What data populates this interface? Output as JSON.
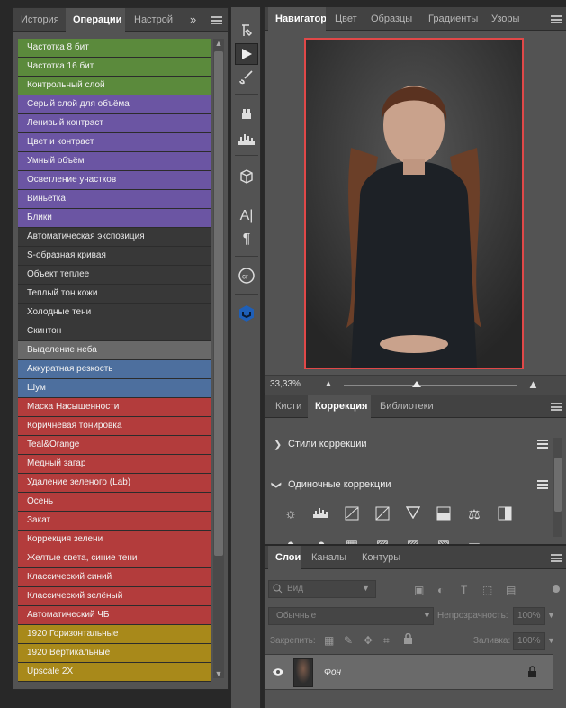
{
  "panel_left": {
    "tabs": [
      "История",
      "Операции",
      "Настрой"
    ],
    "active_tab": "Операции",
    "actions": [
      {
        "label": "Частотка 8 бит",
        "color": "green"
      },
      {
        "label": "Частотка 16 бит",
        "color": "green"
      },
      {
        "label": "Контрольный слой",
        "color": "green"
      },
      {
        "label": "Серый слой для объёма",
        "color": "purple"
      },
      {
        "label": "Ленивый контраст",
        "color": "purple"
      },
      {
        "label": "Цвет и контраст",
        "color": "purple"
      },
      {
        "label": "Умный объём",
        "color": "purple"
      },
      {
        "label": "Осветление участков",
        "color": "purple"
      },
      {
        "label": "Виньетка",
        "color": "purple"
      },
      {
        "label": "Блики",
        "color": "purple"
      },
      {
        "label": "Автоматическая экспозиция",
        "color": "dark"
      },
      {
        "label": "S-образная кривая",
        "color": "dark"
      },
      {
        "label": "Объект теплее",
        "color": "dark"
      },
      {
        "label": "Теплый тон кожи",
        "color": "dark"
      },
      {
        "label": "Холодные тени",
        "color": "dark"
      },
      {
        "label": "Скинтон",
        "color": "dark"
      },
      {
        "label": "Выделение неба",
        "color": "gray"
      },
      {
        "label": "Аккуратная резкость",
        "color": "blue"
      },
      {
        "label": "Шум",
        "color": "blue"
      },
      {
        "label": "Маска Насыщенности",
        "color": "red"
      },
      {
        "label": "Коричневая тонировка",
        "color": "red"
      },
      {
        "label": "Teal&Orange",
        "color": "red"
      },
      {
        "label": "Медный загар",
        "color": "red"
      },
      {
        "label": "Удаление зеленого (Lab)",
        "color": "red"
      },
      {
        "label": "Осень",
        "color": "red"
      },
      {
        "label": "Закат",
        "color": "red"
      },
      {
        "label": "Коррекция зелени",
        "color": "red"
      },
      {
        "label": "Желтые света, синие тени",
        "color": "red"
      },
      {
        "label": "Классический синий",
        "color": "red"
      },
      {
        "label": "Классический зелёный",
        "color": "red"
      },
      {
        "label": "Автоматический ЧБ",
        "color": "red"
      },
      {
        "label": "1920 Горизонтальные",
        "color": "yellow"
      },
      {
        "label": "1920 Вертикальные",
        "color": "yellow"
      },
      {
        "label": "Upscale 2X",
        "color": "yellow"
      }
    ],
    "colors": {
      "green": "#5b8a3c",
      "purple": "#6b55a3",
      "dark": "#383838",
      "gray": "#696969",
      "blue": "#4d6f9e",
      "red": "#b33c3c",
      "yellow": "#a8891a"
    }
  },
  "navigator_panel": {
    "tabs": [
      "Навигатор",
      "Цвет",
      "Образцы",
      "Градиенты",
      "Узоры"
    ],
    "active_tab": "Навигатор",
    "zoom": "33,33%",
    "zoom_slider_fraction": 0.42,
    "view_box_color": "#e04848"
  },
  "adjust_panel": {
    "tabs": [
      "Кисти",
      "Коррекция",
      "Библиотеки"
    ],
    "active_tab": "Коррекция",
    "section1": "Стили коррекции",
    "section2": "Одиночные коррекции"
  },
  "layers_panel": {
    "tabs": [
      "Слои",
      "Каналы",
      "Контуры"
    ],
    "active_tab": "Слои",
    "filter_placeholder": "Вид",
    "blend_mode": "Обычные",
    "opacity_label": "Непрозрачность:",
    "opacity_value": "100%",
    "lock_label": "Закрепить:",
    "fill_label": "Заливка:",
    "fill_value": "100%",
    "layer_name": "Фон"
  }
}
